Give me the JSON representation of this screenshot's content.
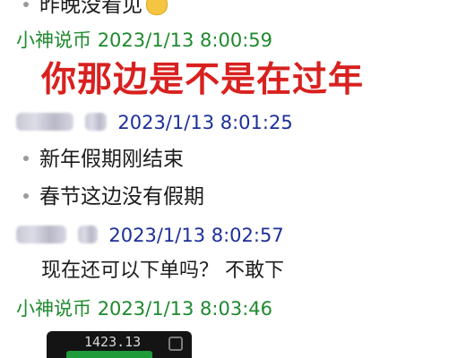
{
  "messages": [
    {
      "kind": "bullet",
      "text": "昨晚没看见"
    },
    {
      "kind": "meta",
      "sender": "小神说币",
      "time": "2023/1/13 8:00:59"
    },
    {
      "kind": "red",
      "text": "你那边是不是在过年"
    },
    {
      "kind": "meta",
      "sender": "",
      "time": "2023/1/13 8:01:25"
    },
    {
      "kind": "bullet",
      "text": "新年假期刚结束"
    },
    {
      "kind": "bullet",
      "text": "春节这边没有假期"
    },
    {
      "kind": "meta",
      "sender": "",
      "time": "2023/1/13 8:02:57"
    },
    {
      "kind": "plain",
      "text": "现在还可以下单吗？ 不敢下"
    },
    {
      "kind": "meta",
      "sender": "小神说币",
      "time": "2023/1/13 8:03:46"
    }
  ],
  "thumbnail": {
    "number": "1423.13"
  },
  "colors": {
    "green_meta": "#1e8a2e",
    "blue_meta": "#1c2f9a",
    "red_text": "#d8211f"
  }
}
